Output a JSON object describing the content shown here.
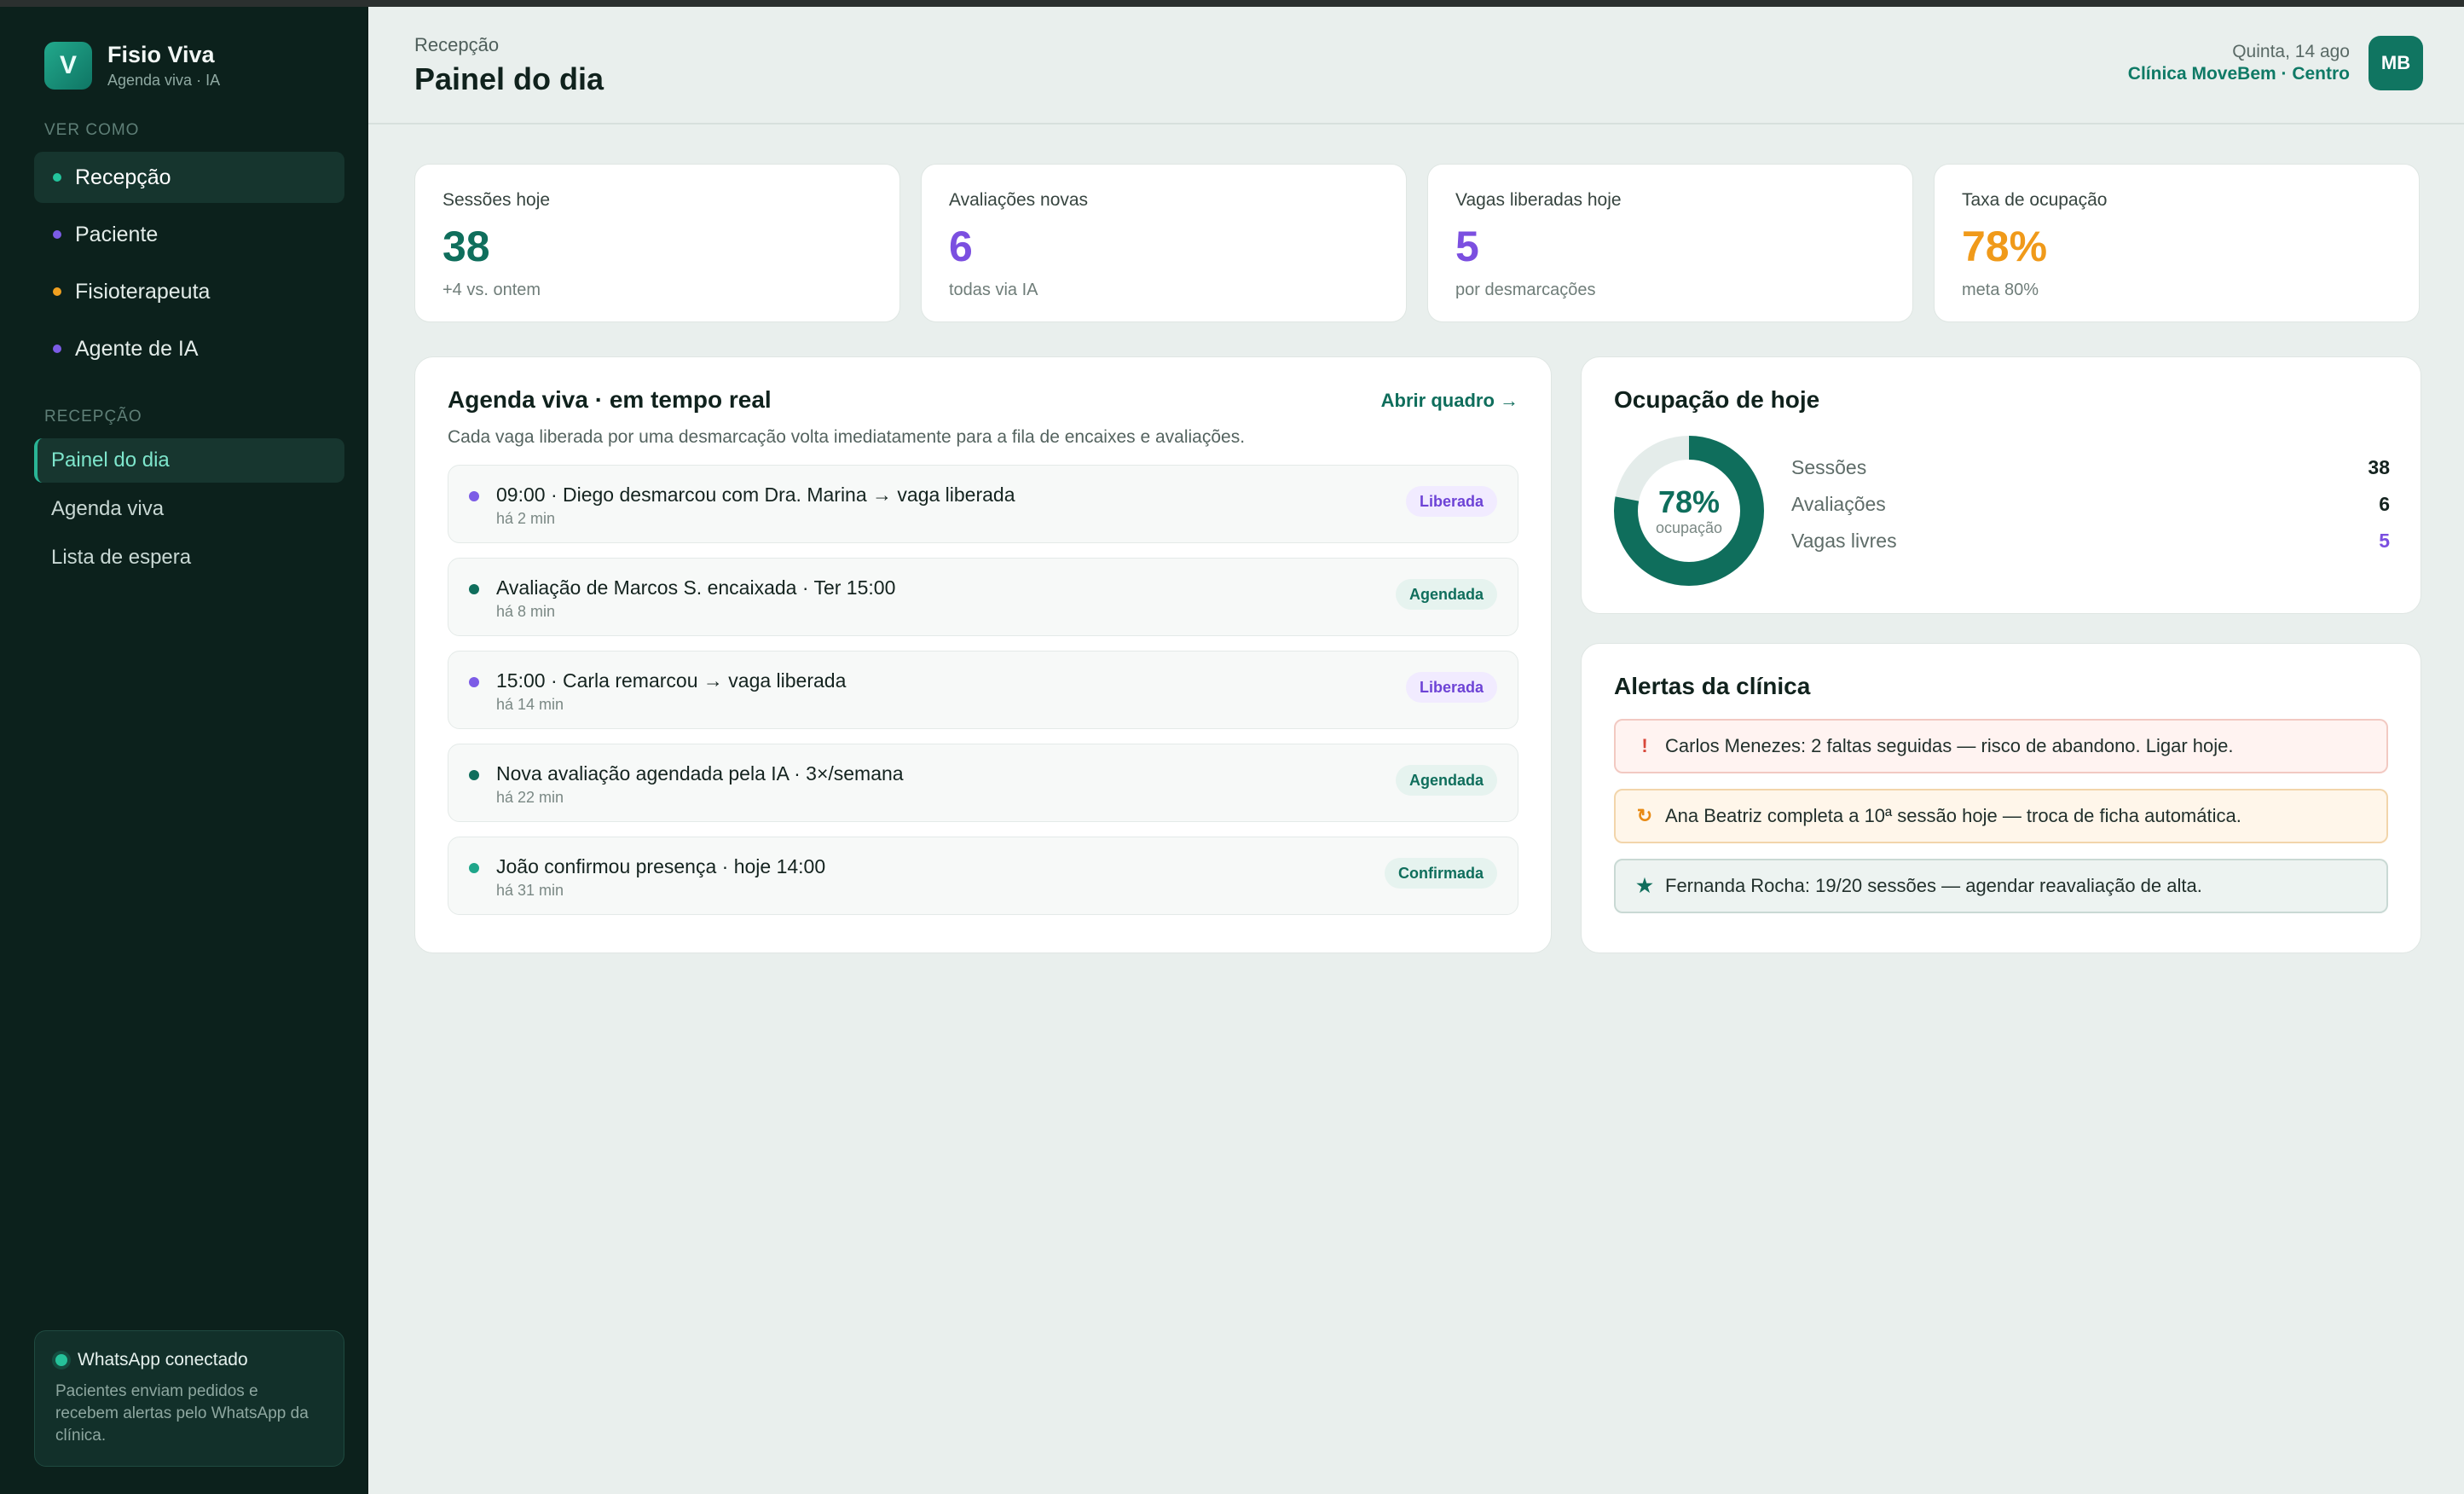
{
  "brand": {
    "logo_letter": "V",
    "name": "Fisio Viva",
    "subtitle": "Agenda viva · IA"
  },
  "sidebar": {
    "view_as_label": "VER COMO",
    "roles": [
      {
        "label": "Recepção",
        "dot_color": "#23c49c",
        "active": true
      },
      {
        "label": "Paciente",
        "dot_color": "#7c5ce6",
        "active": false
      },
      {
        "label": "Fisioterapeuta",
        "dot_color": "#f0a020",
        "active": false
      },
      {
        "label": "Agente de IA",
        "dot_color": "#7c5ce6",
        "active": false
      }
    ],
    "section_label": "RECEPÇÃO",
    "nav": [
      {
        "label": "Painel do dia",
        "active": true
      },
      {
        "label": "Agenda viva",
        "active": false
      },
      {
        "label": "Lista de espera",
        "active": false
      }
    ],
    "whatsapp": {
      "title": "WhatsApp conectado",
      "description": "Pacientes enviam pedidos e recebem alertas pelo WhatsApp da clínica."
    }
  },
  "header": {
    "breadcrumb": "Recepção",
    "title": "Painel do dia",
    "date": "Quinta, 14 ago",
    "clinic": "Clínica MoveBem · Centro",
    "avatar_initials": "MB"
  },
  "stats": [
    {
      "label": "Sessões hoje",
      "value": "38",
      "note": "+4 vs. ontem",
      "color": "#0f6e5c"
    },
    {
      "label": "Avaliações novas",
      "value": "6",
      "note": "todas via IA",
      "color": "#7b4fe0"
    },
    {
      "label": "Vagas liberadas hoje",
      "value": "5",
      "note": "por desmarcações",
      "color": "#7b4fe0"
    },
    {
      "label": "Taxa de ocupação",
      "value": "78%",
      "note": "meta 80%",
      "color": "#f09a1a"
    }
  ],
  "agenda": {
    "title": "Agenda viva · em tempo real",
    "link": "Abrir quadro →",
    "description": "Cada vaga liberada por uma desmarcação volta imediatamente para a fila de encaixes e avaliações.",
    "items": [
      {
        "text": "09:00 · Diego desmarcou com Dra. Marina → vaga liberada",
        "time": "há 2 min",
        "badge": "Liberada",
        "dot": "#7c5ce6",
        "badge_bg": "#f1ebff",
        "badge_fg": "#6d43d6"
      },
      {
        "text": "Avaliação de Marcos S. encaixada · Ter 15:00",
        "time": "há 8 min",
        "badge": "Agendada",
        "dot": "#0f6e5c",
        "badge_bg": "#e6f3ef",
        "badge_fg": "#0f6e5c"
      },
      {
        "text": "15:00 · Carla remarcou → vaga liberada",
        "time": "há 14 min",
        "badge": "Liberada",
        "dot": "#7c5ce6",
        "badge_bg": "#f1ebff",
        "badge_fg": "#6d43d6"
      },
      {
        "text": "Nova avaliação agendada pela IA · 3×/semana",
        "time": "há 22 min",
        "badge": "Agendada",
        "dot": "#0f6e5c",
        "badge_bg": "#e6f3ef",
        "badge_fg": "#0f6e5c"
      },
      {
        "text": "João confirmou presença · hoje 14:00",
        "time": "há 31 min",
        "badge": "Confirmada",
        "dot": "#1fa68a",
        "badge_bg": "#e6f3ef",
        "badge_fg": "#0f6e5c"
      }
    ]
  },
  "occupancy": {
    "title": "Ocupação de hoje",
    "percent": 78,
    "percent_label": "78%",
    "center_label": "ocupação",
    "rows": [
      {
        "label": "Sessões",
        "value": "38",
        "color": "#14231f"
      },
      {
        "label": "Avaliações",
        "value": "6",
        "color": "#14231f"
      },
      {
        "label": "Vagas livres",
        "value": "5",
        "color": "#7b4fe0"
      }
    ]
  },
  "alerts": {
    "title": "Alertas da clínica",
    "items": [
      {
        "icon": "!",
        "icon_name": "exclamation-icon",
        "text": "Carlos Menezes: 2 faltas seguidas — risco de abandono. Ligar hoje.",
        "bg": "#fff3f1",
        "border": "#f2c9c2",
        "icon_color": "#d8473a"
      },
      {
        "icon": "↻",
        "icon_name": "refresh-icon",
        "text": "Ana Beatriz completa a 10ª sessão hoje — troca de ficha automática.",
        "bg": "#fff6ea",
        "border": "#f2d5ab",
        "icon_color": "#e88a14"
      },
      {
        "icon": "★",
        "icon_name": "star-icon",
        "text": "Fernanda Rocha: 19/20 sessões — agendar reavaliação de alta.",
        "bg": "#edf3f1",
        "border": "#c9d9d4",
        "icon_color": "#0f6e5c"
      }
    ]
  }
}
